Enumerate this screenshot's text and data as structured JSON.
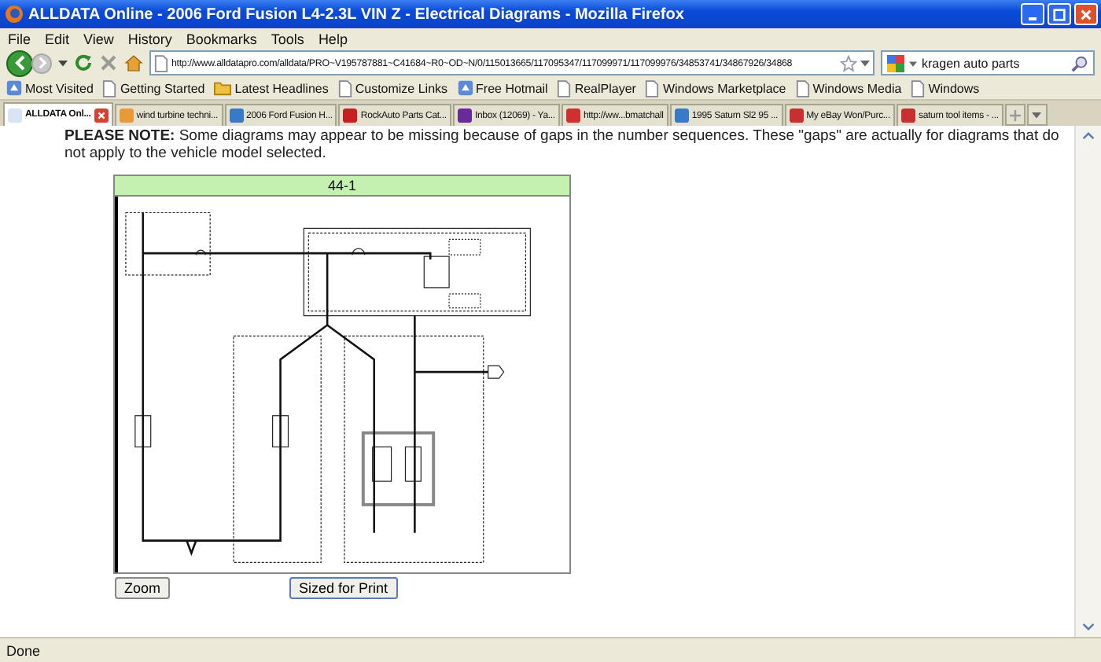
{
  "window": {
    "title": "ALLDATA Online - 2006 Ford Fusion L4-2.3L VIN Z - Electrical Diagrams - Mozilla Firefox"
  },
  "menu": [
    "File",
    "Edit",
    "View",
    "History",
    "Bookmarks",
    "Tools",
    "Help"
  ],
  "address_bar": {
    "value": "http://www.alldatapro.com/alldata/PRO~V195787881~C41684~R0~OD~N/0/115013665/117095347/117099971/117099976/34853741/34867926/34868"
  },
  "search": {
    "value": "kragen auto parts"
  },
  "bookmarks": [
    {
      "label": "Most Visited",
      "kind": "special"
    },
    {
      "label": "Getting Started",
      "kind": "page"
    },
    {
      "label": "Latest Headlines",
      "kind": "folder"
    },
    {
      "label": "Customize Links",
      "kind": "page"
    },
    {
      "label": "Free Hotmail",
      "kind": "special"
    },
    {
      "label": "RealPlayer",
      "kind": "page"
    },
    {
      "label": "Windows Marketplace",
      "kind": "page"
    },
    {
      "label": "Windows Media",
      "kind": "page"
    },
    {
      "label": "Windows",
      "kind": "page"
    }
  ],
  "tabs": [
    {
      "label": "ALLDATA Onl...",
      "selected": true,
      "color": "#d8e4f4"
    },
    {
      "label": "wind turbine techni...",
      "selected": false,
      "color": "#e89a3a"
    },
    {
      "label": "2006 Ford Fusion H...",
      "selected": false,
      "color": "#3a78c8"
    },
    {
      "label": "RockAuto Parts Cat...",
      "selected": false,
      "color": "#c82020"
    },
    {
      "label": "Inbox (12069) - Ya...",
      "selected": false,
      "color": "#6a2a9a"
    },
    {
      "label": "http://ww...bmatchall",
      "selected": false,
      "color": "#d03030"
    },
    {
      "label": "1995 Saturn Sl2 95 ...",
      "selected": false,
      "color": "#3a78c8"
    },
    {
      "label": "My eBay Won/Purc...",
      "selected": false,
      "color": "#c83030"
    },
    {
      "label": "saturn tool items - ...",
      "selected": false,
      "color": "#c83030"
    }
  ],
  "notice": "**PLEASE NOTE:** Some diagrams may appear to be missing because of gaps in the number sequences. These \"gaps\" are actually for diagrams that do not apply to the vehicle model selected.",
  "diagram": {
    "title": "44-1"
  },
  "buttons": [
    "Zoom",
    "Sized for Print"
  ],
  "status_bar": "Done"
}
